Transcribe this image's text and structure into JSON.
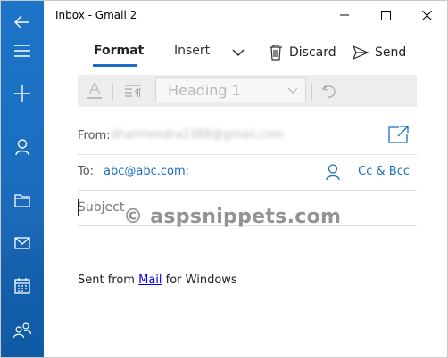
{
  "window": {
    "title": "Inbox - Gmail 2"
  },
  "sidebar": {
    "items": [
      {
        "icon": "back-arrow-icon"
      },
      {
        "icon": "hamburger-menu-icon"
      },
      {
        "icon": "plus-icon"
      },
      {
        "icon": "person-icon"
      },
      {
        "icon": "folder-icon"
      },
      {
        "icon": "mail-icon"
      },
      {
        "icon": "calendar-icon"
      },
      {
        "icon": "people-icon"
      }
    ]
  },
  "toolbar": {
    "tabs": [
      {
        "label": "Format",
        "active": true
      },
      {
        "label": "Insert",
        "active": false
      }
    ],
    "discard_label": "Discard",
    "send_label": "Send"
  },
  "format_strip": {
    "heading_value": "Heading 1"
  },
  "compose": {
    "from_label": "From:",
    "from_value": "dharmendra2388@gmail.com",
    "to_label": "To:",
    "to_value": "abc@abc.com;",
    "cc_bcc_label": "Cc & Bcc",
    "subject_placeholder": "Subject",
    "watermark": "© aspsnippets.com",
    "signature_prefix": "Sent from ",
    "signature_link": "Mail",
    "signature_suffix": " for Windows"
  },
  "colors": {
    "accent": "#1a6fc4",
    "sidebar_top": "#1c74c8",
    "sidebar_bottom": "#0f5aa4"
  }
}
